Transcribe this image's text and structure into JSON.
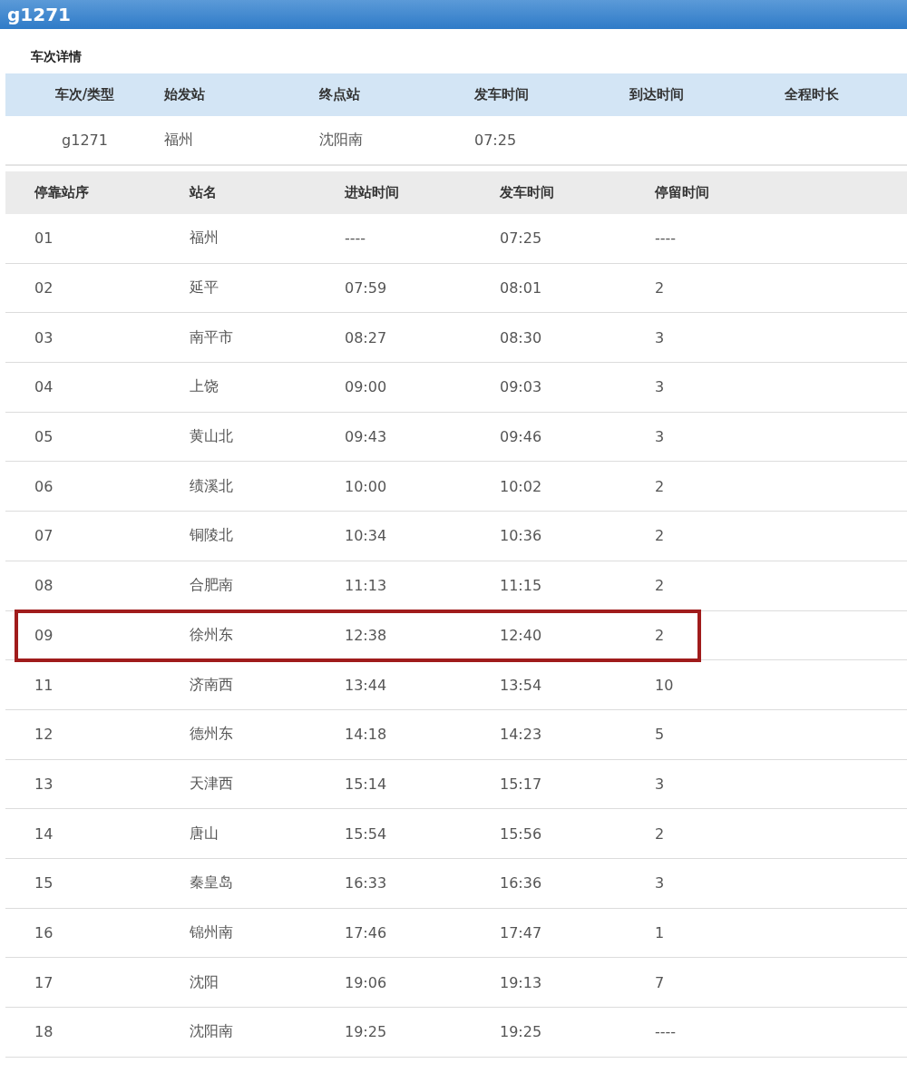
{
  "title": "g1271",
  "details": {
    "heading": "车次详情",
    "columns": [
      "车次/类型",
      "始发站",
      "终点站",
      "发车时间",
      "到达时间",
      "全程时长"
    ],
    "row": [
      "g1271",
      "福州",
      "沈阳南",
      "07:25"
    ]
  },
  "stops": {
    "columns": [
      "停靠站序",
      "站名",
      "进站时间",
      "发车时间",
      "停留时间"
    ],
    "rows": [
      {
        "cells": [
          "01",
          "福州",
          "----",
          "07:25",
          "----"
        ],
        "highlighted": false
      },
      {
        "cells": [
          "02",
          "延平",
          "07:59",
          "08:01",
          "2"
        ],
        "highlighted": false
      },
      {
        "cells": [
          "03",
          "南平市",
          "08:27",
          "08:30",
          "3"
        ],
        "highlighted": false
      },
      {
        "cells": [
          "04",
          "上饶",
          "09:00",
          "09:03",
          "3"
        ],
        "highlighted": false
      },
      {
        "cells": [
          "05",
          "黄山北",
          "09:43",
          "09:46",
          "3"
        ],
        "highlighted": false
      },
      {
        "cells": [
          "06",
          "绩溪北",
          "10:00",
          "10:02",
          "2"
        ],
        "highlighted": false
      },
      {
        "cells": [
          "07",
          "铜陵北",
          "10:34",
          "10:36",
          "2"
        ],
        "highlighted": false
      },
      {
        "cells": [
          "08",
          "合肥南",
          "11:13",
          "11:15",
          "2"
        ],
        "highlighted": false
      },
      {
        "cells": [
          "09",
          "徐州东",
          "12:38",
          "12:40",
          "2"
        ],
        "highlighted": true
      },
      {
        "cells": [
          "11",
          "济南西",
          "13:44",
          "13:54",
          "10"
        ],
        "highlighted": false
      },
      {
        "cells": [
          "12",
          "德州东",
          "14:18",
          "14:23",
          "5"
        ],
        "highlighted": false
      },
      {
        "cells": [
          "13",
          "天津西",
          "15:14",
          "15:17",
          "3"
        ],
        "highlighted": false
      },
      {
        "cells": [
          "14",
          "唐山",
          "15:54",
          "15:56",
          "2"
        ],
        "highlighted": false
      },
      {
        "cells": [
          "15",
          "秦皇岛",
          "16:33",
          "16:36",
          "3"
        ],
        "highlighted": false
      },
      {
        "cells": [
          "16",
          "锦州南",
          "17:46",
          "17:47",
          "1"
        ],
        "highlighted": false
      },
      {
        "cells": [
          "17",
          "沈阳",
          "19:06",
          "19:13",
          "7"
        ],
        "highlighted": false
      },
      {
        "cells": [
          "18",
          "沈阳南",
          "19:25",
          "19:25",
          "----"
        ],
        "highlighted": false
      }
    ]
  }
}
